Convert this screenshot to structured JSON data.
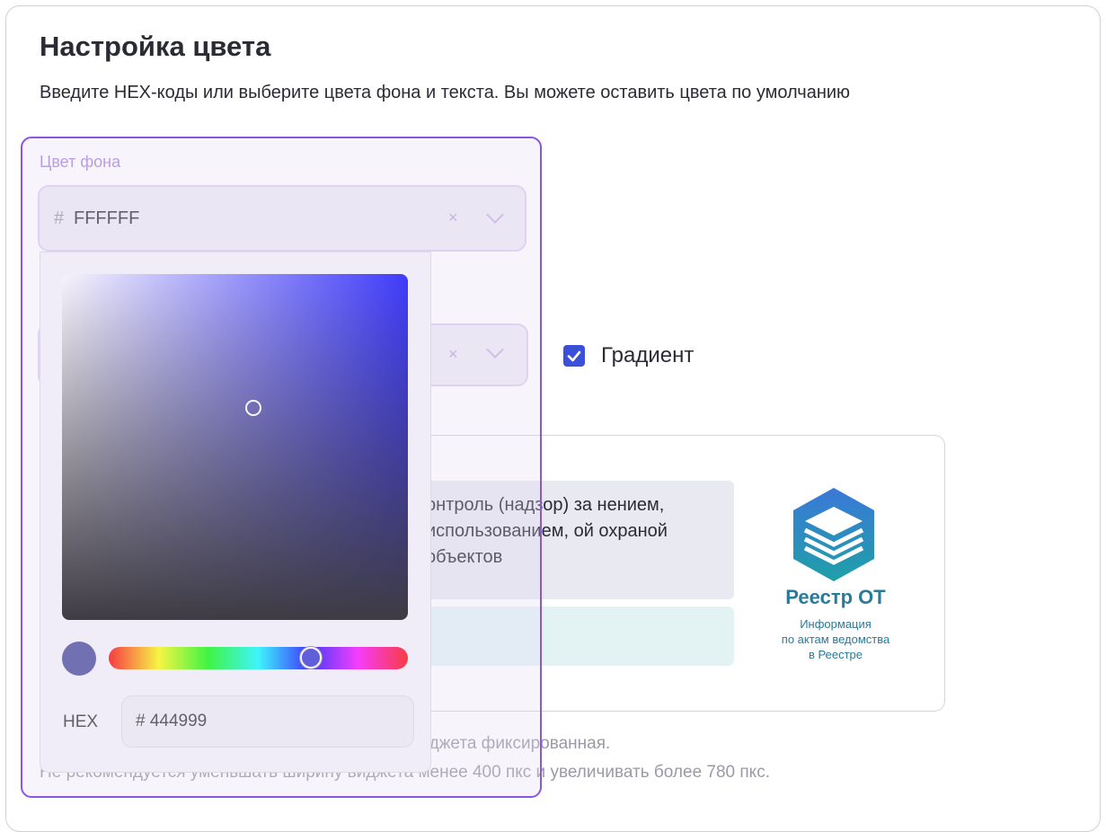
{
  "header": {
    "title": "Настройка цвета",
    "subtitle": "Введите HEX-коды или выберите цвета фона и текста. Вы можете оставить цвета по умолчанию"
  },
  "background_color": {
    "label": "Цвет фона",
    "hash": "#",
    "value": "FFFFFF",
    "clear_icon": "×"
  },
  "gradient": {
    "checked": true,
    "label": "Градиент"
  },
  "preview": {
    "text": "онтроль (надзор) за нением, использованием, ой охраной объектов",
    "logo": {
      "title": "Реестр ОТ",
      "subtitle_lines": [
        "Информация",
        "по актам ведомства",
        "в Реестре"
      ]
    }
  },
  "notes": {
    "line1": "иджета фиксированная.",
    "line2": "Не рекомендуется уменьшать ширину виджета менее 400 пкс и увеличивать более 780 пкс."
  },
  "color_picker": {
    "hue_color": "#0000ff",
    "current_color": "#444999",
    "hex_label": "HEX",
    "hex_value": "# 444999"
  },
  "colors": {
    "accent": "#8a55e0",
    "checkbox": "#3b4fd8",
    "logo": "#2a7a9a"
  }
}
